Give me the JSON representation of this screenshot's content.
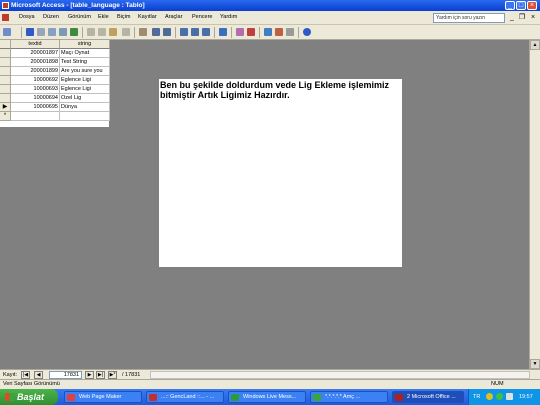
{
  "window": {
    "title": "Microsoft Access - [table_language : Tablo]"
  },
  "menu": {
    "items": [
      "Dosya",
      "Düzen",
      "Görünüm",
      "Ekle",
      "Biçim",
      "Kayıtlar",
      "Araçlar",
      "Pencere",
      "Yardım"
    ],
    "help_placeholder": "Yardım için soru yazın"
  },
  "datasheet": {
    "columns": [
      "textid",
      "string"
    ],
    "rows": [
      {
        "textid": "200001897",
        "string": "Maçı Oynat"
      },
      {
        "textid": "200001898",
        "string": "Test String"
      },
      {
        "textid": "200001899",
        "string": "Are you sure you"
      },
      {
        "textid": "10000692",
        "string": "Eglence Ligi"
      },
      {
        "textid": "10000693",
        "string": "Eglence Ligi"
      },
      {
        "textid": "10000694",
        "string": "Ozel Lig"
      },
      {
        "textid": "10000695",
        "string": "Dünya"
      }
    ],
    "new_row_marker": "*",
    "current_row_marker": "▶"
  },
  "overlay": {
    "message": "Ben bu şekilde doldurdum vede Lig Ekleme işlemimiz bitmiştir Artık Ligimiz Hazırdır."
  },
  "record_nav": {
    "label": "Kayıt:",
    "current": "17831",
    "total": "/ 17831"
  },
  "statusbar": {
    "view": "Veri Sayfası Görünümü",
    "num": "NUM"
  },
  "taskbar": {
    "start": "Başlat",
    "tasks": [
      {
        "label": "Web Page Maker",
        "color": "#e04040"
      },
      {
        "label": "...:: GencLand ::... - ...",
        "color": "#c03030"
      },
      {
        "label": "Windows Live Mess...",
        "color": "#2a9a3a"
      },
      {
        "label": "*.*.*.*.* Amç ...",
        "color": "#3aa63a"
      },
      {
        "label": "2 Microsoft Office ...",
        "color": "#b02020"
      }
    ],
    "tray_lang": "TR",
    "clock": "19:57"
  }
}
